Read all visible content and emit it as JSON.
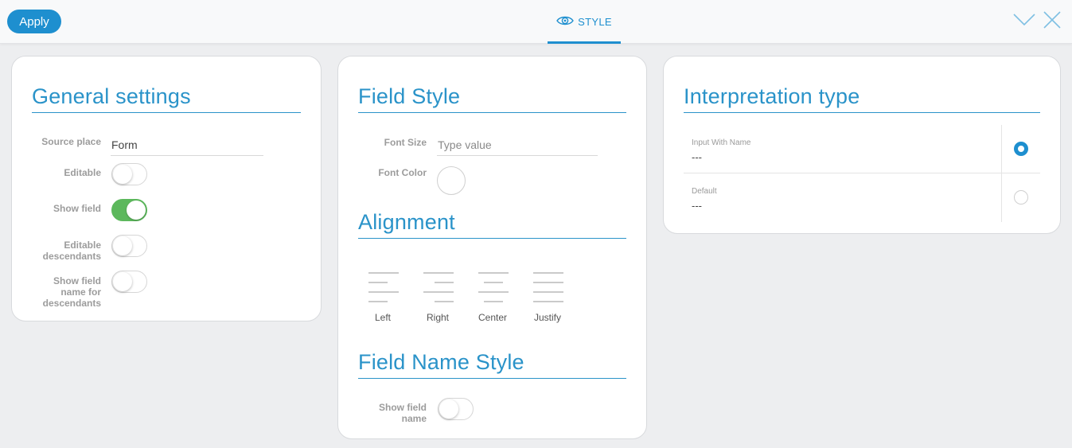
{
  "toolbar": {
    "apply_label": "Apply",
    "tab_label": "STYLE",
    "accent_color": "#1e8fcf"
  },
  "general": {
    "title": "General settings",
    "source_place_label": "Source place",
    "source_place_value": "Form",
    "editable_label": "Editable",
    "editable_on": false,
    "show_field_label": "Show field",
    "show_field_on": true,
    "editable_desc_label_1": "Editable",
    "editable_desc_label_2": "descendants",
    "editable_desc_on": false,
    "show_name_desc_label_1": "Show field",
    "show_name_desc_label_2": "name for",
    "show_name_desc_label_3": "descendants",
    "show_name_desc_on": false
  },
  "field_style": {
    "title": "Field Style",
    "font_size_label": "Font Size",
    "font_size_placeholder": "Type value",
    "font_color_label": "Font Color",
    "alignment_title": "Alignment",
    "alignments": [
      "Left",
      "Right",
      "Center",
      "Justify"
    ],
    "name_style_title": "Field Name Style",
    "show_name_label_1": "Show field",
    "show_name_label_2": "name",
    "show_name_on": false
  },
  "interpretation": {
    "title": "Interpretation type",
    "options": [
      {
        "title": "Input With Name",
        "value": "---",
        "selected": true
      },
      {
        "title": "Default",
        "value": "---",
        "selected": false
      }
    ]
  },
  "icons": {
    "tab": "eye-icon",
    "collapse": "chevron-down-icon",
    "close": "close-icon"
  }
}
